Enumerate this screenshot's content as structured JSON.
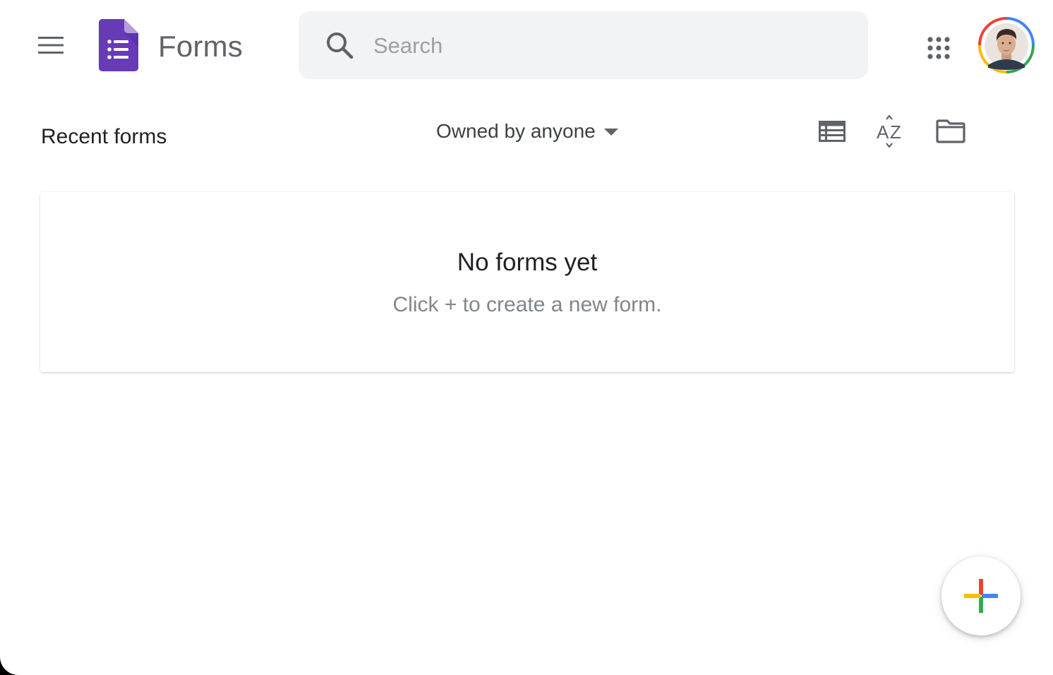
{
  "header": {
    "app_name": "Forms",
    "search": {
      "placeholder": "Search",
      "value": ""
    },
    "icons": {
      "menu": "hamburger-menu-icon",
      "logo": "google-forms-logo",
      "search": "search-icon",
      "apps": "apps-grid-icon",
      "avatar": "user-avatar"
    }
  },
  "toolbar": {
    "section_title": "Recent forms",
    "owner_filter": "Owned by anyone",
    "icons": {
      "list_view": "list-view-icon",
      "sort": "sort-az-icon",
      "folder": "folder-icon"
    }
  },
  "empty_state": {
    "title": "No forms yet",
    "subtitle": "Click + to create a new form."
  },
  "fab": {
    "icon": "plus-icon"
  },
  "colors": {
    "forms_purple": "#673ab7",
    "forms_purple_dark": "#512da8",
    "search_bg": "#f1f3f4",
    "google_red": "#ea4335",
    "google_blue": "#4285f4",
    "google_yellow": "#fbbc04",
    "google_green": "#34a853"
  }
}
